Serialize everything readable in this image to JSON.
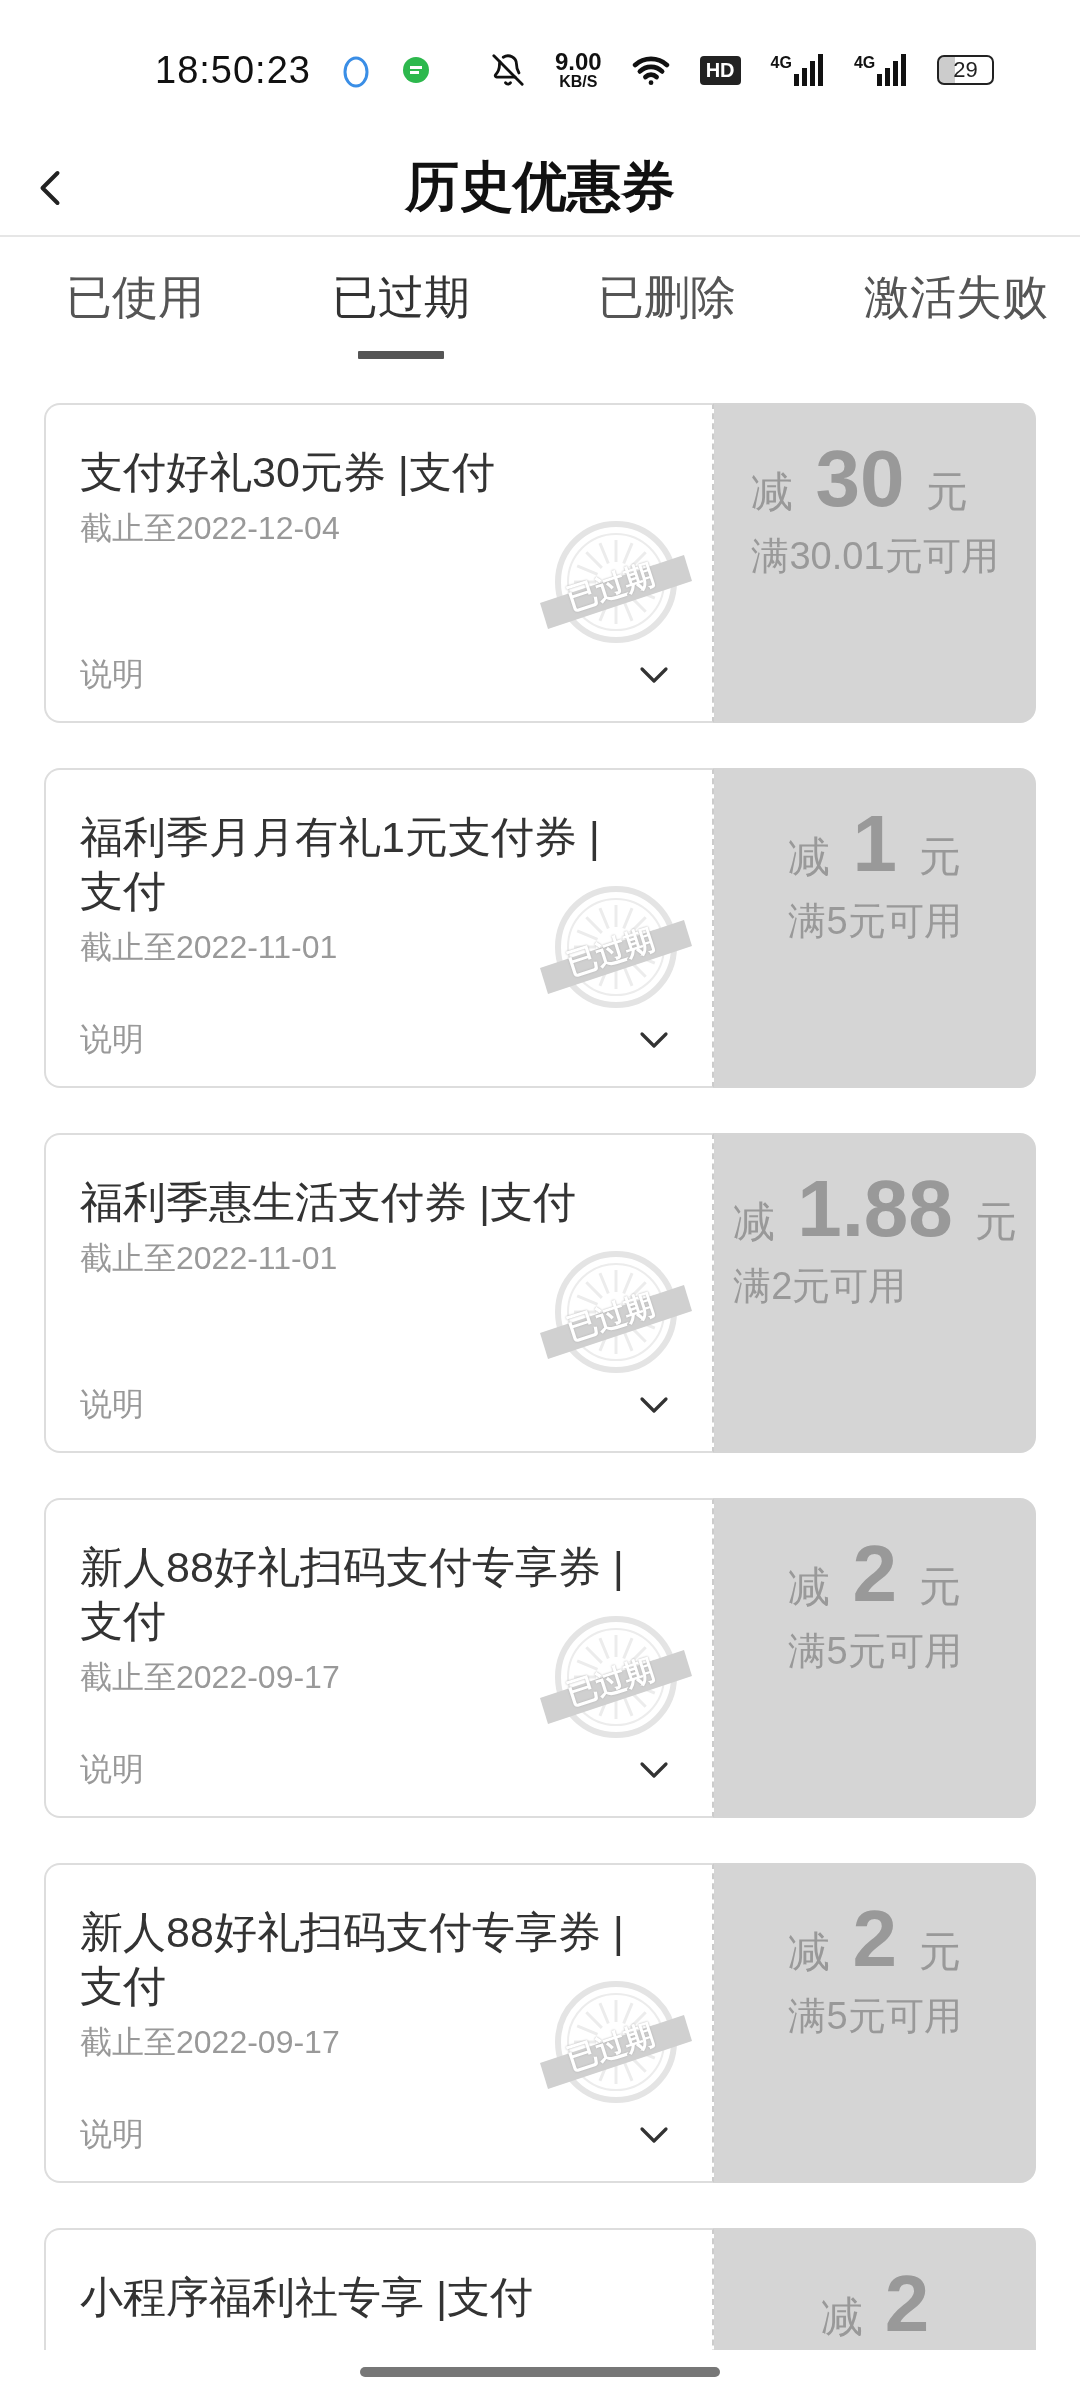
{
  "status_bar": {
    "time": "18:50:23",
    "net_speed": "9.00",
    "net_unit": "KB/S",
    "hd": "HD",
    "signals": [
      "4G",
      "4G"
    ],
    "battery": "29"
  },
  "header": {
    "title": "历史优惠券"
  },
  "tabs": [
    {
      "label": "已使用",
      "selected": false
    },
    {
      "label": "已过期",
      "selected": true
    },
    {
      "label": "已删除",
      "selected": false
    },
    {
      "label": "激活失败",
      "selected": false
    }
  ],
  "coupons": [
    {
      "title": "支付好礼30元券 |支付",
      "deadline": "截止至2022-12-04",
      "stamp": "已过期",
      "note": "说明",
      "prefix": "减",
      "amount": "30",
      "unit": "元",
      "condition": "满30.01元可用"
    },
    {
      "title": "福利季月月有礼1元支付券 |支付",
      "deadline": "截止至2022-11-01",
      "stamp": "已过期",
      "note": "说明",
      "prefix": "减",
      "amount": "1",
      "unit": "元",
      "condition": "满5元可用"
    },
    {
      "title": "福利季惠生活支付券 |支付",
      "deadline": "截止至2022-11-01",
      "stamp": "已过期",
      "note": "说明",
      "prefix": "减",
      "amount": "1.88",
      "unit": "元",
      "condition": "满2元可用"
    },
    {
      "title": "新人88好礼扫码支付专享券 |支付",
      "deadline": "截止至2022-09-17",
      "stamp": "已过期",
      "note": "说明",
      "prefix": "减",
      "amount": "2",
      "unit": "元",
      "condition": "满5元可用"
    },
    {
      "title": "新人88好礼扫码支付专享券 |支付",
      "deadline": "截止至2022-09-17",
      "stamp": "已过期",
      "note": "说明",
      "prefix": "减",
      "amount": "2",
      "unit": "元",
      "condition": "满5元可用"
    },
    {
      "title": "小程序福利社专享 |支付",
      "prefix": "减",
      "amount": "2"
    }
  ]
}
